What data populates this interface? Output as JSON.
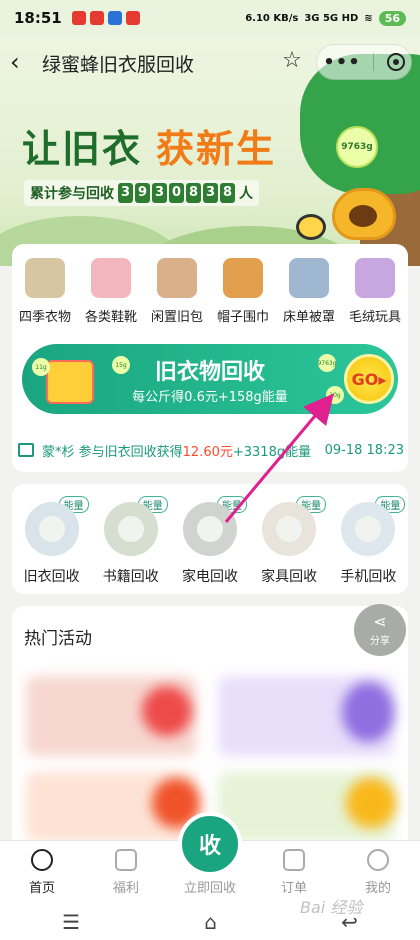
{
  "status": {
    "time": "18:51",
    "net_speed": "6.10 KB/s",
    "signal": "3G 5G HD",
    "battery": "56"
  },
  "nav": {
    "title": "绿蜜蜂旧衣服回收"
  },
  "hero": {
    "slogan_a": "让旧衣",
    "slogan_b": "获新生",
    "energy_bubble": "9763g",
    "counter_prefix": "累计参与回收",
    "counter_digits": [
      "3",
      "9",
      "3",
      "0",
      "8",
      "3",
      "8"
    ],
    "counter_suffix": "人"
  },
  "categories": [
    {
      "label": "四季衣物",
      "color": "#d8c6a2"
    },
    {
      "label": "各类鞋靴",
      "color": "#f2b7bd"
    },
    {
      "label": "闲置旧包",
      "color": "#d9b08a"
    },
    {
      "label": "帽子围巾",
      "color": "#e29f4e"
    },
    {
      "label": "床单被罩",
      "color": "#9fb7d1"
    },
    {
      "label": "毛绒玩具",
      "color": "#c8a6e0"
    }
  ],
  "banner": {
    "title": "旧衣物回收",
    "subtitle": "每公斤得0.6元+158g能量",
    "go": "GO",
    "chip1": "11g",
    "chip2": "15g",
    "chip3": "9763g",
    "chip4": "10g"
  },
  "ticker": {
    "user_text": "蒙*杉 参与旧衣回收获得",
    "money": "12.60元",
    "energy": "+3318g能量",
    "time": "09-18 18:23"
  },
  "recycle": [
    {
      "label": "旧衣回收",
      "badge": "能量",
      "color": "#7fa9d6"
    },
    {
      "label": "书籍回收",
      "badge": "能量",
      "color": "#6f8f4e"
    },
    {
      "label": "家电回收",
      "badge": "能量",
      "color": "#555555"
    },
    {
      "label": "家具回收",
      "badge": "能量",
      "color": "#c9a98a"
    },
    {
      "label": "手机回收",
      "badge": "能量",
      "color": "#8fb8e8"
    }
  ],
  "activity": {
    "header": "热门活动"
  },
  "share": {
    "label": "分享"
  },
  "center_button": {
    "text": "收"
  },
  "tabs": [
    {
      "label": "首页",
      "active": true
    },
    {
      "label": "福利",
      "active": false
    },
    {
      "label": "立即回收",
      "active": false
    },
    {
      "label": "订单",
      "active": false
    },
    {
      "label": "我的",
      "active": false
    }
  ],
  "watermark": "Bai 经验"
}
